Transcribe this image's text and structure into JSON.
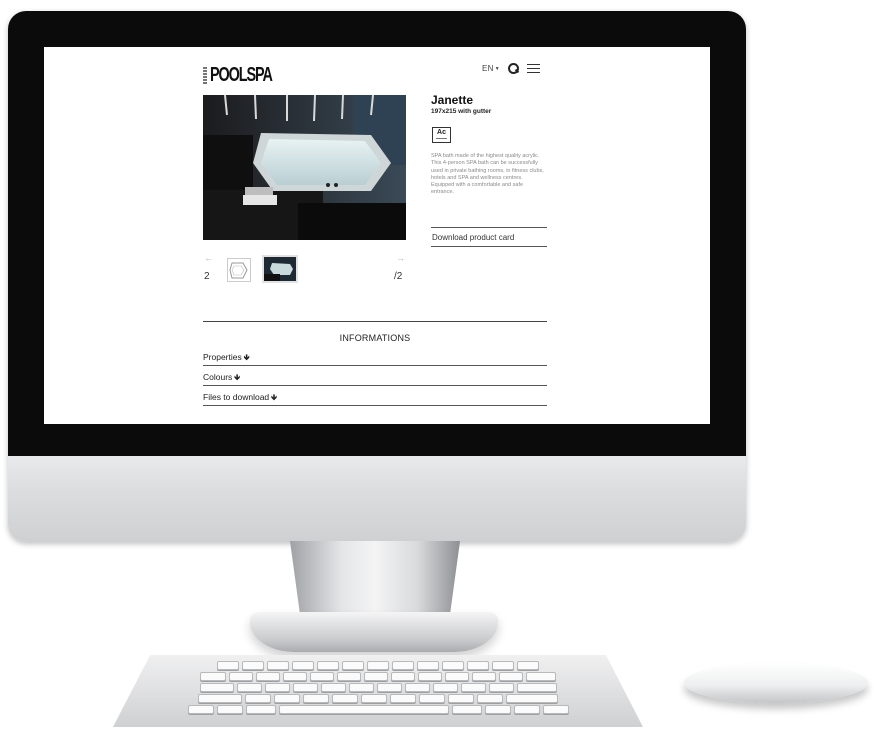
{
  "site": {
    "logo_text": "POOLSPA",
    "nav": {
      "language": "EN",
      "caret": "▼"
    },
    "product": {
      "title": "Janette",
      "subtitle": "197x215 with gutter",
      "material_badge": "Ac",
      "description": "SPA bath made of the highest quality acrylic. This 4-person SPA bath can be successfully used in private bathing rooms, in fitness clubs, hotels and SPA and wellness centres. Equipped with a comfortable and safe entrance.",
      "download_label": "Download product card"
    },
    "gallery": {
      "current": "2",
      "total": "/2",
      "prev_arrow": "←",
      "next_arrow": "→"
    },
    "informations": {
      "heading": "INFORMATIONS",
      "items": [
        {
          "label": "Properties",
          "icon": "arrow-down-icon"
        },
        {
          "label": "Colours",
          "icon": "arrow-down-icon"
        },
        {
          "label": "Files to download",
          "icon": "arrow-down-icon"
        }
      ],
      "arrow_glyph": "🡻"
    }
  }
}
